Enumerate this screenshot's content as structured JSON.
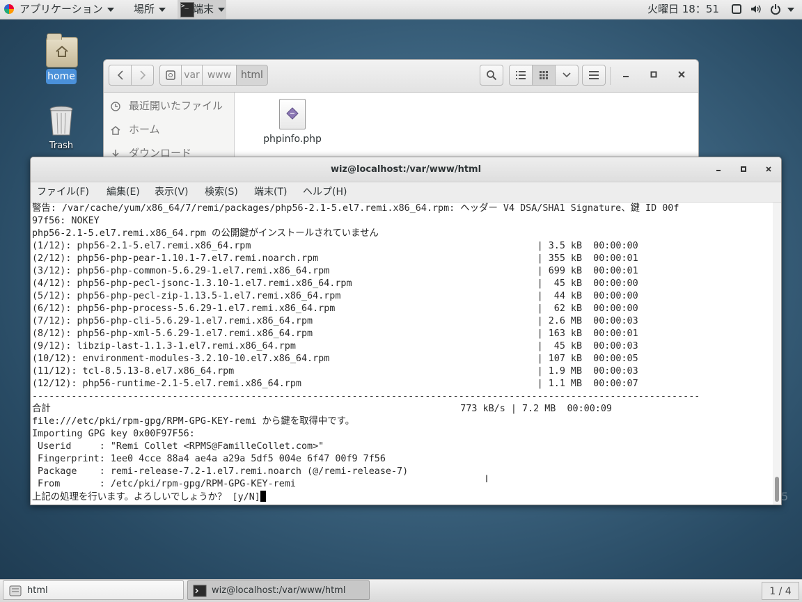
{
  "top_bar": {
    "applications": "アプリケーション",
    "places": "場所",
    "terminal": "端末",
    "clock": "火曜日 18：51",
    "tray_icons": [
      "screen-icon",
      "volume-icon",
      "power-icon"
    ]
  },
  "desktop": {
    "home_label": "home",
    "trash_label": "Trash",
    "corner_fragment": "5"
  },
  "file_manager": {
    "path": [
      "var",
      "www",
      "html"
    ],
    "sidebar": [
      {
        "label": "最近開いたファイル",
        "icon": "clock-icon"
      },
      {
        "label": "ホーム",
        "icon": "home-icon"
      },
      {
        "label": "ダウンロード",
        "icon": "download-icon"
      }
    ],
    "files": [
      {
        "name": "phpinfo.php",
        "icon": "php-file-icon"
      }
    ]
  },
  "terminal": {
    "title": "wiz@localhost:/var/www/html",
    "menu": [
      "ファイル(F)",
      "編集(E)",
      "表示(V)",
      "検索(S)",
      "端末(T)",
      "ヘルプ(H)"
    ],
    "lines": [
      "警告: /var/cache/yum/x86_64/7/remi/packages/php56-2.1-5.el7.remi.x86_64.rpm: ヘッダー V4 DSA/SHA1 Signature、鍵 ID 00f",
      "97f56: NOKEY",
      "php56-2.1-5.el7.remi.x86_64.rpm の公開鍵がインストールされていません",
      "(1/12): php56-2.1-5.el7.remi.x86_64.rpm                                                   | 3.5 kB  00:00:00",
      "(2/12): php56-php-pear-1.10.1-7.el7.remi.noarch.rpm                                       | 355 kB  00:00:01",
      "(3/12): php56-php-common-5.6.29-1.el7.remi.x86_64.rpm                                     | 699 kB  00:00:01",
      "(4/12): php56-php-pecl-jsonc-1.3.10-1.el7.remi.x86_64.rpm                                 |  45 kB  00:00:00",
      "(5/12): php56-php-pecl-zip-1.13.5-1.el7.remi.x86_64.rpm                                   |  44 kB  00:00:00",
      "(6/12): php56-php-process-5.6.29-1.el7.remi.x86_64.rpm                                    |  62 kB  00:00:00",
      "(7/12): php56-php-cli-5.6.29-1.el7.remi.x86_64.rpm                                        | 2.6 MB  00:00:03",
      "(8/12): php56-php-xml-5.6.29-1.el7.remi.x86_64.rpm                                        | 163 kB  00:00:01",
      "(9/12): libzip-last-1.1.3-1.el7.remi.x86_64.rpm                                           |  45 kB  00:00:03",
      "(10/12): environment-modules-3.2.10-10.el7.x86_64.rpm                                     | 107 kB  00:00:05",
      "(11/12): tcl-8.5.13-8.el7.x86_64.rpm                                                      | 1.9 MB  00:00:03",
      "(12/12): php56-runtime-2.1-5.el7.remi.x86_64.rpm                                          | 1.1 MB  00:00:07",
      "-----------------------------------------------------------------------------------------------------------------------",
      "合計                                                                         773 kB/s | 7.2 MB  00:00:09",
      "file:///etc/pki/rpm-gpg/RPM-GPG-KEY-remi から鍵を取得中です。",
      "Importing GPG key 0x00F97F56:",
      " Userid     : \"Remi Collet <RPMS@FamilleCollet.com>\"",
      " Fingerprint: 1ee0 4cce 88a4 ae4a a29a 5df5 004e 6f47 00f9 7f56",
      " Package    : remi-release-7.2-1.el7.remi.noarch (@/remi-release-7)",
      " From       : /etc/pki/rpm-gpg/RPM-GPG-KEY-remi",
      "上記の処理を行います。よろしいでしょうか？ [y/N]"
    ]
  },
  "bottom_bar": {
    "tasks": [
      "html",
      "wiz@localhost:/var/www/html"
    ],
    "workspace": "1 / 4"
  }
}
